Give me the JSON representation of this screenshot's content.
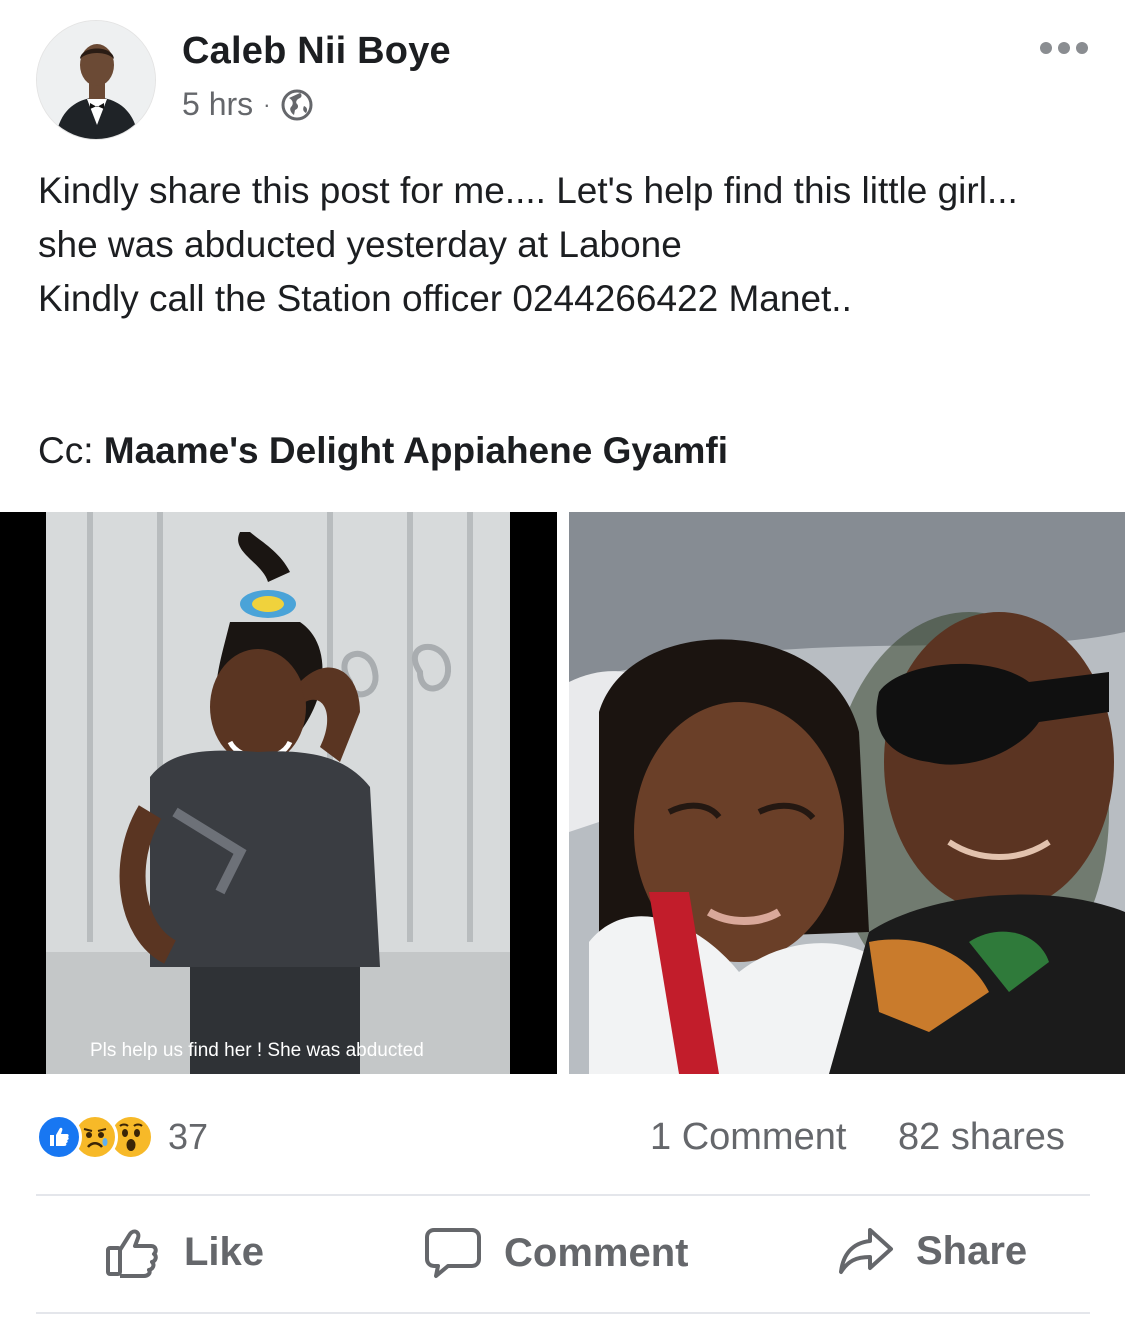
{
  "post": {
    "author": "Caleb Nii Boye",
    "time": "5 hrs",
    "separator": "·",
    "privacy_icon": "globe-icon",
    "menu_icon": "more-options-icon",
    "text_lines": [
      "Kindly share this post for me.... Let's help find this little girl...",
      "she was abducted yesterday at Labone",
      "Kindly call the Station officer 0244266422 Manet.."
    ],
    "cc_label": "Cc:",
    "cc_mention": "Maame's Delight Appiahene Gyamfi",
    "photo_caption": "Pls help us find her ! She was abducted"
  },
  "stats": {
    "reaction_icons": [
      "like-reaction-icon",
      "sad-reaction-icon",
      "wow-reaction-icon"
    ],
    "reaction_count": "37",
    "comments": "1 Comment",
    "shares": "82 shares"
  },
  "actions": {
    "like": "Like",
    "comment": "Comment",
    "share": "Share"
  },
  "colors": {
    "like_blue": "#1877f2",
    "emoji_yellow": "#f7b928",
    "secondary_text": "#65676b"
  }
}
